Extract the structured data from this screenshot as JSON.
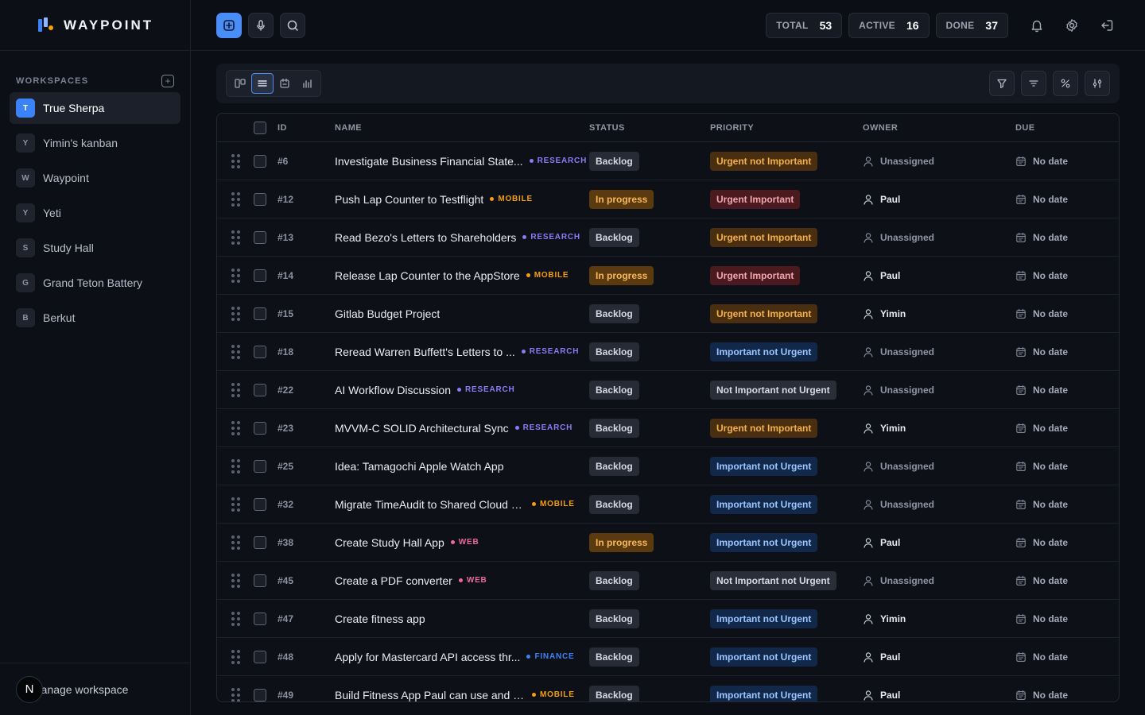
{
  "brand": {
    "name": "WAYPOINT"
  },
  "sidebar": {
    "section_title": "WORKSPACES",
    "workspaces": [
      {
        "initial": "T",
        "name": "True Sherpa",
        "active": true
      },
      {
        "initial": "Y",
        "name": "Yimin's kanban",
        "active": false
      },
      {
        "initial": "W",
        "name": "Waypoint",
        "active": false
      },
      {
        "initial": "Y",
        "name": "Yeti",
        "active": false
      },
      {
        "initial": "S",
        "name": "Study Hall",
        "active": false
      },
      {
        "initial": "G",
        "name": "Grand Teton Battery",
        "active": false
      },
      {
        "initial": "B",
        "name": "Berkut",
        "active": false
      }
    ],
    "footer": {
      "avatar_initial": "N",
      "label": "Manage workspace"
    }
  },
  "topbar": {
    "stats": [
      {
        "label": "TOTAL",
        "value": "53"
      },
      {
        "label": "ACTIVE",
        "value": "16"
      },
      {
        "label": "DONE",
        "value": "37"
      }
    ]
  },
  "table": {
    "columns": {
      "id": "ID",
      "name": "NAME",
      "status": "STATUS",
      "priority": "PRIORITY",
      "owner": "OWNER",
      "due": "DUE"
    },
    "rows": [
      {
        "id": "#6",
        "name": "Investigate Business Financial State...",
        "tag": "RESEARCH",
        "status": "Backlog",
        "priority": "Urgent not Important",
        "owner": "Unassigned",
        "due": "No date"
      },
      {
        "id": "#12",
        "name": "Push Lap Counter to Testflight",
        "tag": "MOBILE",
        "status": "In progress",
        "priority": "Urgent Important",
        "owner": "Paul",
        "due": "No date"
      },
      {
        "id": "#13",
        "name": "Read Bezo's Letters to Shareholders",
        "tag": "RESEARCH",
        "status": "Backlog",
        "priority": "Urgent not Important",
        "owner": "Unassigned",
        "due": "No date"
      },
      {
        "id": "#14",
        "name": "Release Lap Counter to the AppStore",
        "tag": "MOBILE",
        "status": "In progress",
        "priority": "Urgent Important",
        "owner": "Paul",
        "due": "No date"
      },
      {
        "id": "#15",
        "name": "Gitlab Budget Project",
        "tag": "",
        "status": "Backlog",
        "priority": "Urgent not Important",
        "owner": "Yimin",
        "due": "No date"
      },
      {
        "id": "#18",
        "name": "Reread Warren Buffett's Letters to ...",
        "tag": "RESEARCH",
        "status": "Backlog",
        "priority": "Important not Urgent",
        "owner": "Unassigned",
        "due": "No date"
      },
      {
        "id": "#22",
        "name": "AI Workflow Discussion",
        "tag": "RESEARCH",
        "status": "Backlog",
        "priority": "Not Important not Urgent",
        "owner": "Unassigned",
        "due": "No date"
      },
      {
        "id": "#23",
        "name": "MVVM-C SOLID Architectural Sync",
        "tag": "RESEARCH",
        "status": "Backlog",
        "priority": "Urgent not Important",
        "owner": "Yimin",
        "due": "No date"
      },
      {
        "id": "#25",
        "name": "Idea: Tamagochi Apple Watch App",
        "tag": "",
        "status": "Backlog",
        "priority": "Important not Urgent",
        "owner": "Unassigned",
        "due": "No date"
      },
      {
        "id": "#32",
        "name": "Migrate TimeAudit to Shared Cloud D...",
        "tag": "MOBILE",
        "status": "Backlog",
        "priority": "Important not Urgent",
        "owner": "Unassigned",
        "due": "No date"
      },
      {
        "id": "#38",
        "name": "Create Study Hall App",
        "tag": "WEB",
        "status": "In progress",
        "priority": "Important not Urgent",
        "owner": "Paul",
        "due": "No date"
      },
      {
        "id": "#45",
        "name": "Create a PDF converter",
        "tag": "WEB",
        "status": "Backlog",
        "priority": "Not Important not Urgent",
        "owner": "Unassigned",
        "due": "No date"
      },
      {
        "id": "#47",
        "name": "Create fitness app",
        "tag": "",
        "status": "Backlog",
        "priority": "Important not Urgent",
        "owner": "Yimin",
        "due": "No date"
      },
      {
        "id": "#48",
        "name": "Apply for Mastercard API access thr...",
        "tag": "FINANCE",
        "status": "Backlog",
        "priority": "Important not Urgent",
        "owner": "Paul",
        "due": "No date"
      },
      {
        "id": "#49",
        "name": "Build Fitness App Paul can use and pr...",
        "tag": "MOBILE",
        "status": "Backlog",
        "priority": "Important not Urgent",
        "owner": "Paul",
        "due": "No date"
      }
    ]
  },
  "colors": {
    "accent": "#4a8df7",
    "tag_research": "#8b7cf6",
    "tag_mobile": "#f59e0b",
    "tag_web": "#ec6aa0",
    "tag_finance": "#3b82f6",
    "status_backlog_bg": "#262b35",
    "status_progress_bg": "#5c3a10",
    "priority_urgent_not_important_bg": "#4a2e10",
    "priority_urgent_important_bg": "#4a1a1f",
    "priority_important_not_urgent_bg": "#11284a",
    "priority_not_important_bg": "#2a2e38"
  }
}
